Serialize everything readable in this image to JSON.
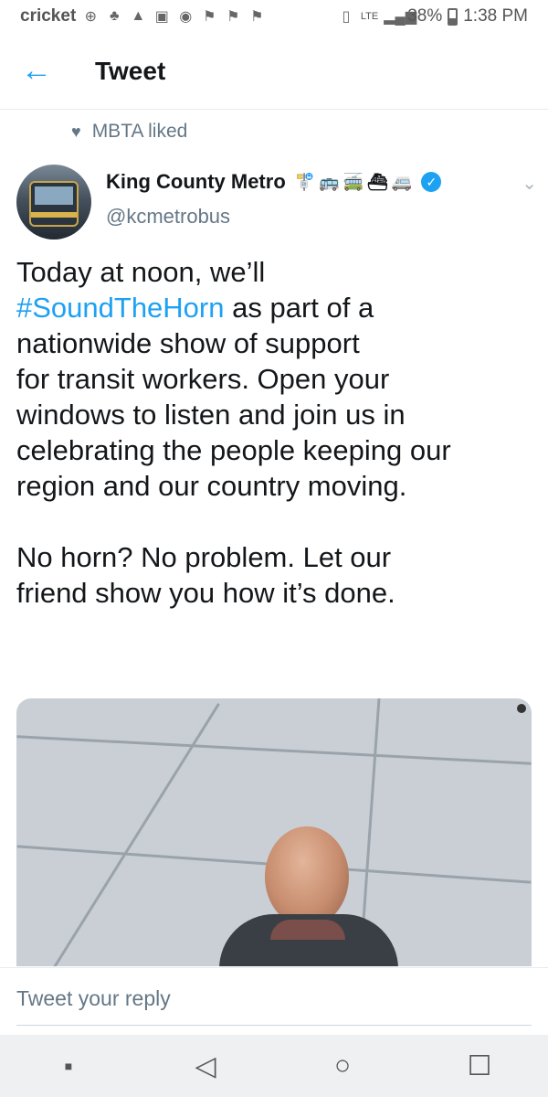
{
  "status_bar": {
    "carrier": "cricket",
    "network": "LTE",
    "battery": "38%",
    "time": "1:38 PM",
    "icons": [
      "plus-circle-icon",
      "tree-icon",
      "alert-icon",
      "image-icon",
      "chrome-icon",
      "flag-icon",
      "flag-icon",
      "flag-icon",
      "vibrate-icon",
      "signal-icon",
      "battery-icon"
    ]
  },
  "app_bar": {
    "title": "Tweet",
    "back_icon": "arrow-left-icon"
  },
  "tweet": {
    "social_context": "MBTA liked",
    "author_name": "King County Metro",
    "author_handle": "@kcmetrobus",
    "author_emojis": [
      "bus-stop-icon",
      "bus-icon",
      "trolleybus-icon",
      "ferry-icon",
      "minibus-icon"
    ],
    "verified": true,
    "text_before_hashtag": "Today at noon, we’ll\n",
    "hashtag": "#SoundTheHorn",
    "text_after_hashtag": " as part of a\nnationwide show of support\nfor transit workers. Open your\nwindows to listen and join us in\ncelebrating the people keeping our\nregion and our country moving.\n\nNo horn? No problem. Let our\nfriend show you how it’s done."
  },
  "reply": {
    "placeholder": "Tweet your reply"
  },
  "nav_bar": {
    "buttons": [
      "recents-dot-icon",
      "back-triangle-icon",
      "home-circle-icon",
      "overview-square-icon"
    ]
  },
  "colors": {
    "accent": "#1da1f2",
    "text": "#14171a",
    "secondary": "#657786"
  }
}
